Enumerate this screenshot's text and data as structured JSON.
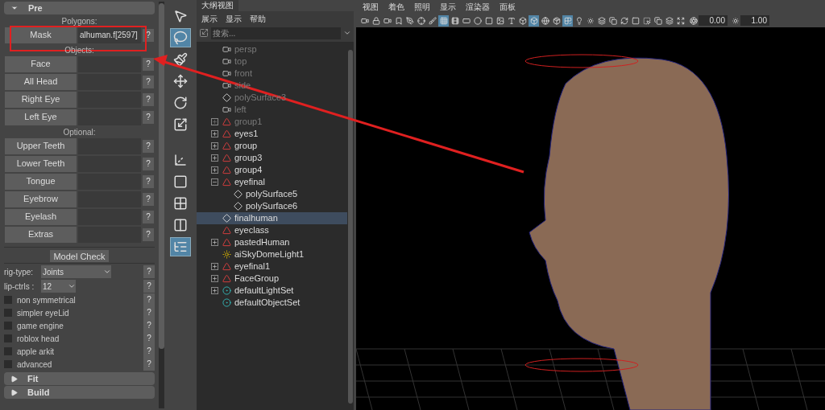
{
  "left_panel": {
    "sections": [
      {
        "title": "Pre",
        "expanded": true
      },
      {
        "title": "Fit",
        "expanded": false
      },
      {
        "title": "Build",
        "expanded": false
      }
    ],
    "groups": [
      {
        "label": "Polygons:",
        "rows": [
          {
            "button": "Mask",
            "value": "alhuman.f[2597]",
            "help": "?"
          }
        ]
      },
      {
        "label": "Objects:",
        "rows": [
          {
            "button": "Face",
            "value": "",
            "help": "?"
          },
          {
            "button": "All Head",
            "value": "",
            "help": "?"
          },
          {
            "button": "Right Eye",
            "value": "",
            "help": "?"
          },
          {
            "button": "Left Eye",
            "value": "",
            "help": "?"
          }
        ]
      },
      {
        "label": "Optional:",
        "rows": [
          {
            "button": "Upper Teeth",
            "value": "",
            "help": "?"
          },
          {
            "button": "Lower Teeth",
            "value": "",
            "help": "?"
          },
          {
            "button": "Tongue",
            "value": "",
            "help": "?"
          },
          {
            "button": "Eyebrow",
            "value": "",
            "help": "?"
          },
          {
            "button": "Eyelash",
            "value": "",
            "help": "?"
          },
          {
            "button": "Extras",
            "value": "",
            "help": "?"
          }
        ]
      }
    ],
    "model_check": "Model Check",
    "dropdowns": [
      {
        "label": "rig-type:",
        "value": "Joints",
        "help": "?"
      },
      {
        "label": "lip-ctrls :",
        "value": "12",
        "help": "?"
      }
    ],
    "options": [
      {
        "label": "non symmetrical",
        "checked": false,
        "help": "?"
      },
      {
        "label": "simpler eyeLid",
        "checked": false,
        "help": "?"
      },
      {
        "label": "game engine",
        "checked": false,
        "help": "?"
      },
      {
        "label": "roblox head",
        "checked": false,
        "help": "?"
      },
      {
        "label": "apple arkit",
        "checked": false,
        "help": "?"
      },
      {
        "label": "advanced",
        "checked": false,
        "help": "?"
      }
    ]
  },
  "toolbox": [
    {
      "kind": "select",
      "selected": false
    },
    {
      "kind": "lasso",
      "selected": true
    },
    {
      "kind": "paint",
      "selected": false
    },
    {
      "kind": "move",
      "selected": false
    },
    {
      "kind": "rotate",
      "selected": false
    },
    {
      "kind": "scale",
      "selected": false
    },
    {
      "kind": "axes",
      "selected": false
    },
    {
      "kind": "single",
      "selected": false
    },
    {
      "kind": "four",
      "selected": false
    },
    {
      "kind": "two",
      "selected": false
    },
    {
      "kind": "outliner",
      "selected": true
    }
  ],
  "outliner": {
    "tab": "大纲视图",
    "menu": [
      "展示",
      "显示",
      "帮助"
    ],
    "search": {
      "placeholder": "搜索..."
    },
    "items": [
      {
        "label": "persp",
        "kind": "camera",
        "dimmed": true,
        "selected": false
      },
      {
        "label": "top",
        "kind": "camera",
        "dimmed": true,
        "selected": false
      },
      {
        "label": "front",
        "kind": "camera",
        "dimmed": true,
        "selected": false
      },
      {
        "label": "side",
        "kind": "camera",
        "dimmed": true,
        "selected": false
      },
      {
        "label": "polySurface3",
        "kind": "mesh",
        "dimmed": true,
        "selected": false
      },
      {
        "label": "left",
        "kind": "camera",
        "dimmed": true,
        "selected": false
      },
      {
        "label": "group1",
        "kind": "group",
        "dimmed": true,
        "selected": false,
        "expanded": false
      },
      {
        "label": "eyes1",
        "kind": "group",
        "dimmed": false,
        "selected": false,
        "expanded": false
      },
      {
        "label": "group",
        "kind": "group",
        "dimmed": false,
        "selected": false,
        "expanded": false
      },
      {
        "label": "group3",
        "kind": "group",
        "dimmed": false,
        "selected": false,
        "expanded": false
      },
      {
        "label": "group4",
        "kind": "group",
        "dimmed": false,
        "selected": false,
        "expanded": false
      },
      {
        "label": "eyefinal",
        "kind": "group",
        "dimmed": false,
        "selected": false,
        "expanded": true,
        "children": [
          {
            "label": "polySurface5",
            "kind": "mesh",
            "dimmed": false,
            "selected": false
          },
          {
            "label": "polySurface6",
            "kind": "mesh",
            "dimmed": false,
            "selected": false
          }
        ]
      },
      {
        "label": "finalhuman",
        "kind": "mesh",
        "dimmed": false,
        "selected": true
      },
      {
        "label": "eyeclass",
        "kind": "group",
        "dimmed": false,
        "selected": false
      },
      {
        "label": "pastedHuman",
        "kind": "group",
        "dimmed": false,
        "selected": false,
        "expanded": false
      },
      {
        "label": "aiSkyDomeLight1",
        "kind": "light",
        "dimmed": false,
        "selected": false
      },
      {
        "label": "eyefinal1",
        "kind": "group",
        "dimmed": false,
        "selected": false,
        "expanded": false
      },
      {
        "label": "FaceGroup",
        "kind": "group",
        "dimmed": false,
        "selected": false,
        "expanded": false
      },
      {
        "label": "defaultLightSet",
        "kind": "set",
        "dimmed": false,
        "selected": false,
        "expanded": false
      },
      {
        "label": "defaultObjectSet",
        "kind": "set",
        "dimmed": false,
        "selected": false
      }
    ]
  },
  "viewport": {
    "menu": [
      "视图",
      "着色",
      "照明",
      "显示",
      "渲染器",
      "面板"
    ],
    "tools": [
      {
        "kind": "camera",
        "selected": false
      },
      {
        "kind": "lock",
        "selected": false
      },
      {
        "kind": "camera",
        "selected": false
      },
      {
        "kind": "bookmark",
        "selected": false
      },
      {
        "kind": "pen",
        "selected": false
      },
      {
        "kind": "target",
        "selected": false
      },
      {
        "kind": "brush",
        "selected": false
      },
      {
        "kind": "grid",
        "selected": true
      },
      {
        "kind": "film",
        "selected": false
      },
      {
        "kind": "gate",
        "selected": false
      },
      {
        "kind": "circle",
        "selected": false
      },
      {
        "kind": "field",
        "selected": false
      },
      {
        "kind": "image",
        "selected": false
      },
      {
        "kind": "type",
        "selected": false
      },
      {
        "kind": "cube",
        "selected": false
      },
      {
        "kind": "cube",
        "selected": true
      },
      {
        "kind": "sphere",
        "selected": false
      },
      {
        "kind": "box",
        "selected": false
      },
      {
        "kind": "checker",
        "selected": true
      },
      {
        "kind": "light",
        "selected": false
      },
      {
        "kind": "shadow",
        "selected": false
      },
      {
        "kind": "layers",
        "selected": false
      },
      {
        "kind": "copy",
        "selected": false
      },
      {
        "kind": "refresh",
        "selected": false
      },
      {
        "kind": "square",
        "selected": false
      },
      {
        "kind": "cursor",
        "selected": false
      },
      {
        "kind": "copy",
        "selected": false
      },
      {
        "kind": "layers",
        "selected": false
      },
      {
        "kind": "expand",
        "selected": false
      }
    ],
    "fields": [
      {
        "kind": "aperture",
        "value": "0.00"
      },
      {
        "kind": "gamma",
        "value": "1.00"
      }
    ]
  }
}
